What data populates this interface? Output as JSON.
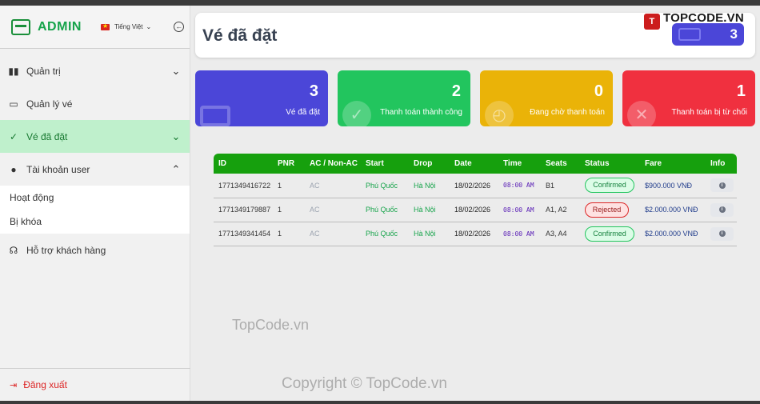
{
  "brand": {
    "title": "ADMIN",
    "language": "Tiếng Việt"
  },
  "sidebar": {
    "items": [
      {
        "label": "Quản trị",
        "icon": "bar-chart-icon",
        "arrow": "⌄"
      },
      {
        "label": "Quản lý vé",
        "icon": "ticket-icon",
        "arrow": ""
      },
      {
        "label": "Vé đã đặt",
        "icon": "check-icon",
        "arrow": "⌄"
      },
      {
        "label": "Tài khoản user",
        "icon": "user-icon",
        "arrow": "⌃"
      }
    ],
    "sub_items": [
      "Hoạt động",
      "Bị khóa"
    ],
    "support": "Hỗ trợ khách hàng",
    "logout": "Đăng xuất"
  },
  "header": {
    "title": "Vé đã đặt",
    "counter": "3"
  },
  "watermark": {
    "top": "TOPCODE.VN",
    "middle": "TopCode.vn",
    "bottom": "Copyright © TopCode.vn"
  },
  "stats": [
    {
      "value": "3",
      "label": "Vé đã đặt",
      "color": "#4b46d8"
    },
    {
      "value": "2",
      "label": "Thanh toán thành công",
      "color": "#22c55e"
    },
    {
      "value": "0",
      "label": "Đang chờ thanh toán",
      "color": "#eab308"
    },
    {
      "value": "1",
      "label": "Thanh toán bị từ chối",
      "color": "#f0303f"
    }
  ],
  "table": {
    "headers": [
      "ID",
      "PNR",
      "AC / Non-AC",
      "Start",
      "Drop",
      "Date",
      "Time",
      "Seats",
      "Status",
      "Fare",
      "Info"
    ],
    "rows": [
      {
        "id": "1771349416722",
        "pnr": "1",
        "ac": "AC",
        "start": "Phú Quốc",
        "drop": "Hà Nội",
        "date": "18/02/2026",
        "time": "08:00 AM",
        "seats": "B1",
        "status": "Confirmed",
        "fare": "$900.000 VNĐ"
      },
      {
        "id": "1771349179887",
        "pnr": "1",
        "ac": "AC",
        "start": "Phú Quốc",
        "drop": "Hà Nội",
        "date": "18/02/2026",
        "time": "08:00 AM",
        "seats": "A1, A2",
        "status": "Rejected",
        "fare": "$2.000.000 VNĐ"
      },
      {
        "id": "1771349341454",
        "pnr": "1",
        "ac": "AC",
        "start": "Phú Quốc",
        "drop": "Hà Nội",
        "date": "18/02/2026",
        "time": "08:00 AM",
        "seats": "A3, A4",
        "status": "Confirmed",
        "fare": "$2.000.000 VNĐ"
      }
    ]
  }
}
